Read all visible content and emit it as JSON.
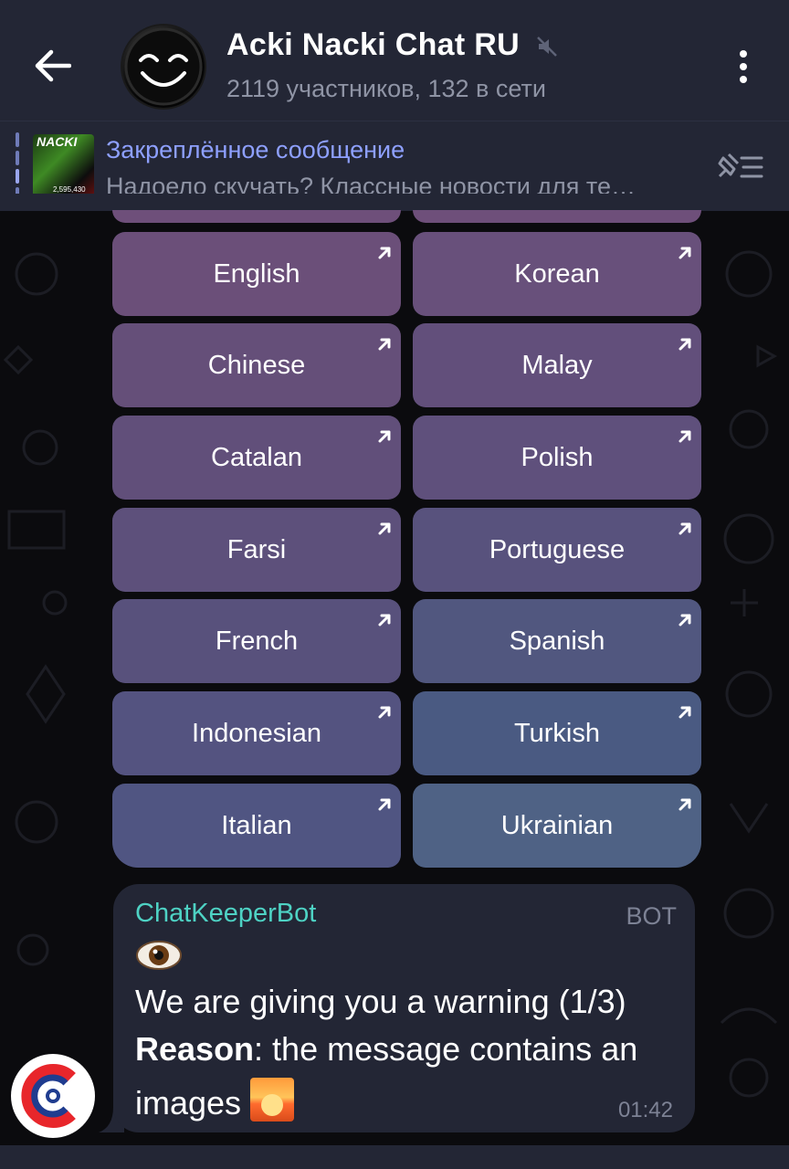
{
  "header": {
    "title": "Acki Nacki Chat RU",
    "subtitle": "2119 участников, 132 в сети",
    "icons": [
      "back-arrow-icon",
      "mute-icon",
      "more-vertical-icon"
    ]
  },
  "pinned": {
    "label": "Закреплённое сообщение",
    "text": "Надоело скучать? Классные новости для те…",
    "thumb_title": "NACKI",
    "thumb_caption": "2,595,430",
    "icon": "pin-list-icon"
  },
  "keyboard": {
    "rows": [
      {
        "left": "English",
        "right": "Korean"
      },
      {
        "left": "Chinese",
        "right": "Malay"
      },
      {
        "left": "Catalan",
        "right": "Polish"
      },
      {
        "left": "Farsi",
        "right": "Portuguese"
      },
      {
        "left": "French",
        "right": "Spanish"
      },
      {
        "left": "Indonesian",
        "right": "Turkish"
      },
      {
        "left": "Italian",
        "right": "Ukrainian"
      }
    ],
    "button_icon": "open-link-arrow-icon"
  },
  "message": {
    "sender": "ChatKeeperBot",
    "tag": "BOT",
    "emoji": "eye-icon",
    "line1": "We are giving you a warning (1/3)",
    "reason_label": "Reason",
    "reason_text": ": the message contains an",
    "line3": "images",
    "image_emoji": "sunrise-icon",
    "time": "01:42"
  },
  "colors": {
    "header_bg": "#232635",
    "accent_link": "#8ea0ff",
    "sender_color": "#4ed2c4",
    "muted_text": "#8f94a5"
  }
}
